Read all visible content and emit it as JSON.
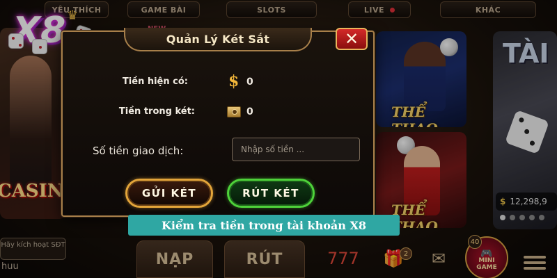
{
  "top_nav": {
    "tabs": [
      "YÊU THÍCH",
      "GAME BÀI",
      "SLOTS",
      "LIVE",
      "KHÁC"
    ]
  },
  "logo": {
    "text": "X8"
  },
  "background": {
    "new_badge": "NEW",
    "casino_label": "CASINO",
    "sports_label_1": "THỂ THAO",
    "sports_label_2": "THỂ THAO",
    "tai_label": "TÀI",
    "jackpot_value": "12,298,9"
  },
  "bottom_bar": {
    "activate_label": "Hãy kích hoạt SĐT",
    "username": "huu",
    "deposit_label": "NẠP",
    "withdraw_label": "RÚT",
    "gift_badge": "2",
    "minigame_count": "40",
    "minigame_label_1": "MINI",
    "minigame_label_2": "GAME"
  },
  "modal": {
    "title": "Quản Lý Két Sắt",
    "close_symbol": "✕",
    "current_money_label": "Tiền hiện có:",
    "current_money_value": "0",
    "safe_money_label": "Tiền trong két:",
    "safe_money_value": "0",
    "amount_label": "Số tiền giao dịch:",
    "amount_placeholder": "Nhập số tiền ...",
    "amount_value": "",
    "deposit_button": "GỬI KÉT",
    "withdraw_button": "RÚT KÉT"
  },
  "caption": "Kiểm tra tiền trong tài khoản X8"
}
